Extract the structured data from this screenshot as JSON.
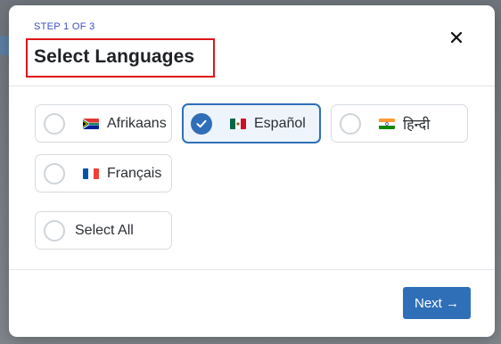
{
  "modal": {
    "step_label": "STEP 1 OF 3",
    "title": "Select Languages",
    "close_icon": "close-icon"
  },
  "options": [
    {
      "label": "Afrikaans",
      "flag": "south-africa-flag",
      "selected": false
    },
    {
      "label": "Español",
      "flag": "mexico-flag",
      "selected": true
    },
    {
      "label": "हिन्दी",
      "flag": "india-flag",
      "selected": false
    },
    {
      "label": "Français",
      "flag": "france-flag",
      "selected": false
    },
    {
      "label": "Select All",
      "flag": null,
      "selected": false
    }
  ],
  "footer": {
    "next_label": "Next →"
  },
  "colors": {
    "accent": "#2f6fb8",
    "selected_bg": "#eef4fc",
    "step_label": "#3b4fc4",
    "highlight_box": "#e0141c"
  }
}
